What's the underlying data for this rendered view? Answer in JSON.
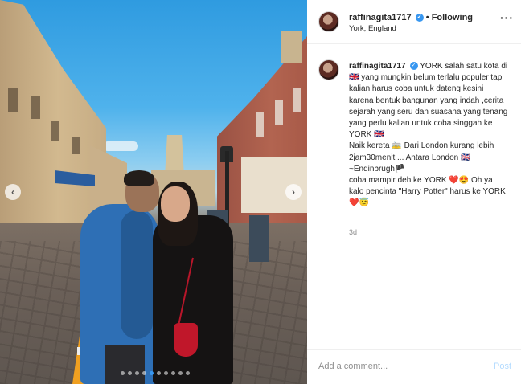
{
  "header": {
    "username": "raffinagita1717",
    "verified_icon": "verified-badge-icon",
    "separator": "•",
    "follow_status": "Following",
    "location": "York, England",
    "more_label": "···"
  },
  "photo": {
    "prev_arrow": "‹",
    "next_arrow": "›",
    "carousel_count": 10,
    "active_index": 4
  },
  "caption": {
    "username": "raffinagita1717",
    "text": "YORK salah satu kota di 🇬🇧 yang mungkin belum terlalu populer tapi kalian harus coba untuk dateng kesini karena bentuk bangunan yang indah ,cerita sejarah yang seru dan suasana yang tenang yang perlu kalian untuk coba singgah ke YORK 🇬🇧\nNaik kereta 🚋 Dari London kurang lebih 2jam30menit ... Antara London 🇬🇧~Endinbrugh🏴\ncoba mampir deh ke YORK ❤️😍 Oh ya kalo pencinta \"Harry Potter\" harus ke YORK ❤️😇",
    "age": "3d"
  },
  "comment_box": {
    "placeholder": "Add a comment...",
    "post_label": "Post"
  },
  "colors": {
    "accent": "#3897f0",
    "post_disabled": "#b3dbff",
    "muted_text": "#8e8e8e"
  }
}
